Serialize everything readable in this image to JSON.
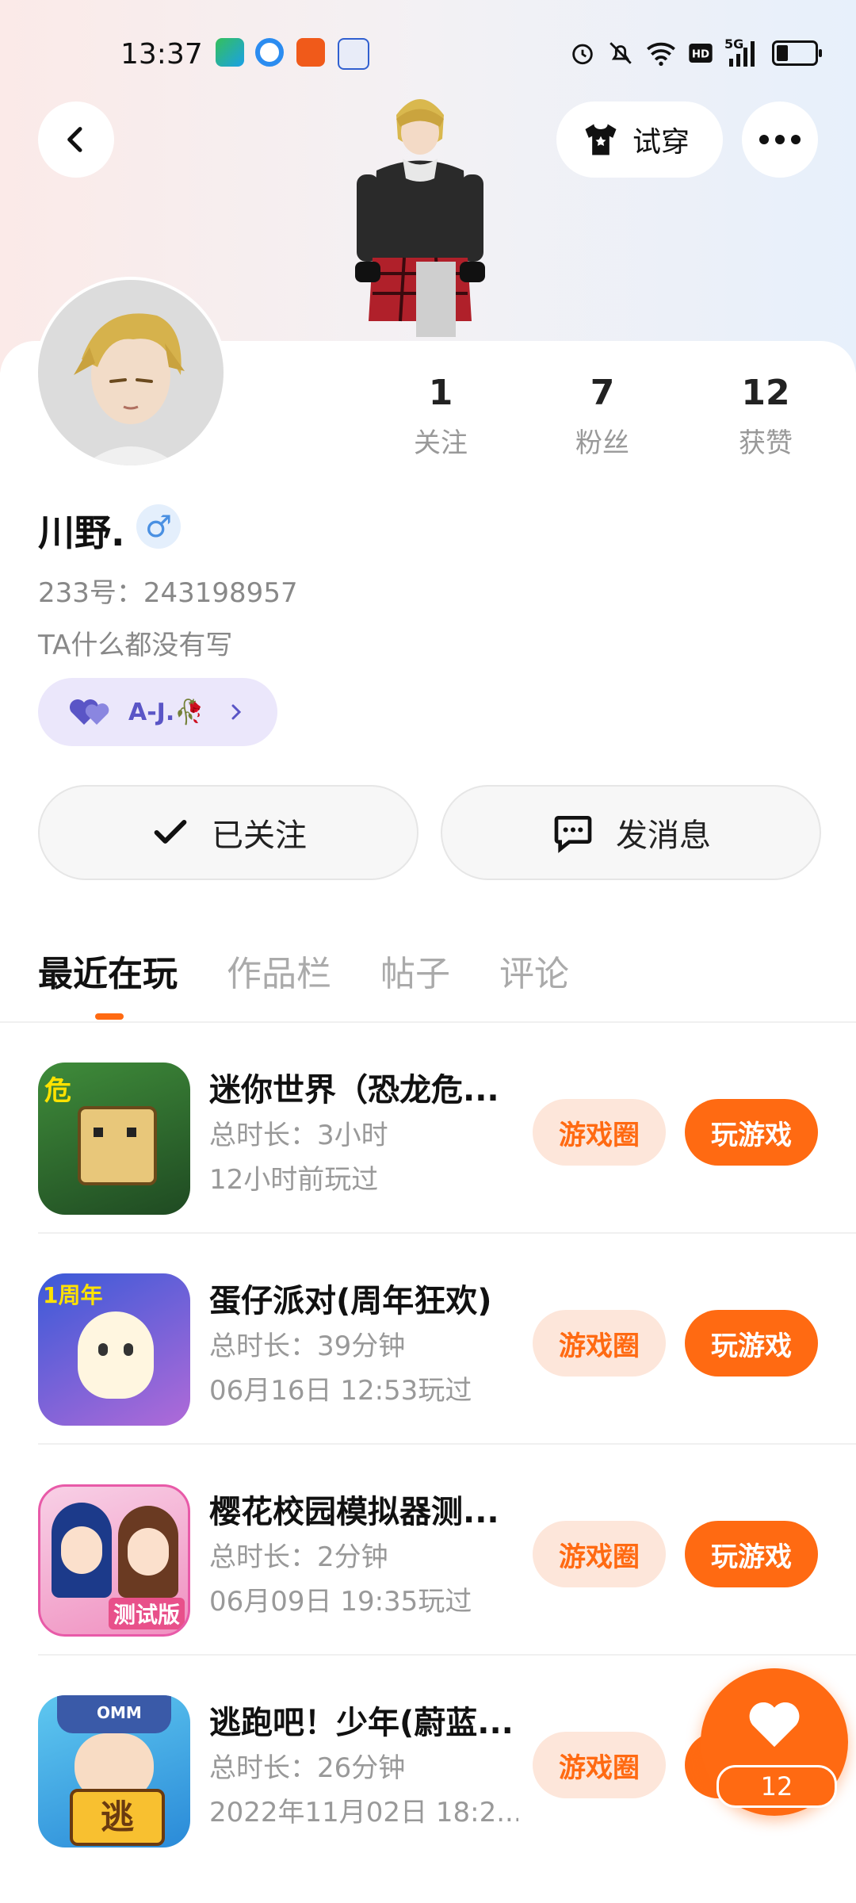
{
  "status_bar": {
    "time": "13:37",
    "network": "5G"
  },
  "header": {
    "try_on_label": "试穿"
  },
  "profile": {
    "name": "川野.",
    "gender_symbol": "♂",
    "id_text": "233号：243198957",
    "bio": "TA什么都没有写",
    "couple_label": "A-J.🥀"
  },
  "stats": [
    {
      "value": "1",
      "label": "关注"
    },
    {
      "value": "7",
      "label": "粉丝"
    },
    {
      "value": "12",
      "label": "获赞"
    }
  ],
  "actions": {
    "follow_label": "已关注",
    "message_label": "发消息"
  },
  "tabs": [
    "最近在玩",
    "作品栏",
    "帖子",
    "评论"
  ],
  "games": [
    {
      "title": "迷你世界（恐龙危...",
      "duration": "总时长：3小时",
      "last_played": "12小时前玩过",
      "circle_label": "游戏圈",
      "play_label": "玩游戏"
    },
    {
      "title": "蛋仔派对(周年狂欢)",
      "duration": "总时长：39分钟",
      "last_played": "06月16日 12:53玩过",
      "circle_label": "游戏圈",
      "play_label": "玩游戏"
    },
    {
      "title": "樱花校园模拟器测...",
      "duration": "总时长：2分钟",
      "last_played": "06月09日 19:35玩过",
      "circle_label": "游戏圈",
      "play_label": "玩游戏"
    },
    {
      "title": "逃跑吧！少年(蔚蓝...",
      "duration": "总时长：26分钟",
      "last_played": "2022年11月02日 18:2...",
      "circle_label": "游戏圈",
      "play_label": "玩游戏"
    }
  ],
  "icon_text": {
    "game1_badge": "危",
    "game2_badge": "1周年",
    "game3_badge": "测试版",
    "game4_top": "OMM",
    "game4_badge": "逃"
  },
  "fab": {
    "count": "12"
  },
  "colors": {
    "accent": "#ff6a12",
    "accent_soft": "#fde6da",
    "couple_bg": "#ebe7fb",
    "couple_text": "#5a55c6"
  }
}
